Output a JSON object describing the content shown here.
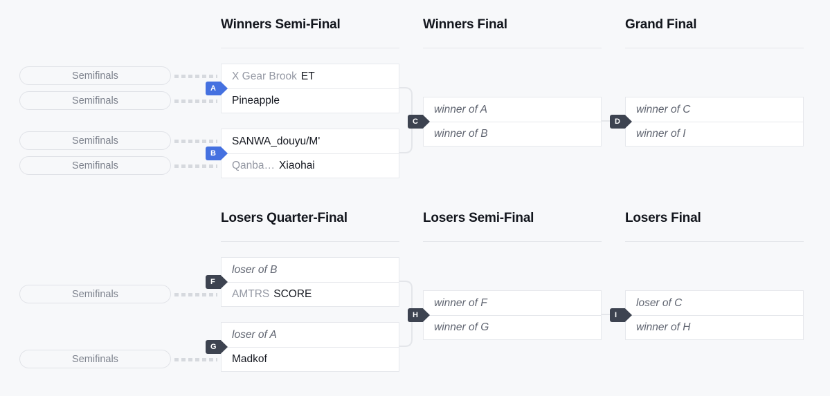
{
  "theme": {
    "background": "#f7f8fa",
    "card_background": "#ffffff",
    "border": "#e6e8ec",
    "heading_color": "#12151c",
    "badge_blue": "#4571e0",
    "badge_dark": "#3d4350",
    "placeholder_color": "#5f6470",
    "prefix_color": "#9498a3"
  },
  "rounds": [
    {
      "id": "winners-semi-final",
      "title": "Winners Semi-Final"
    },
    {
      "id": "winners-final",
      "title": "Winners Final"
    },
    {
      "id": "grand-final",
      "title": "Grand Final"
    },
    {
      "id": "losers-quarter-final",
      "title": "Losers Quarter-Final"
    },
    {
      "id": "losers-semi-final",
      "title": "Losers Semi-Final"
    },
    {
      "id": "losers-final",
      "title": "Losers Final"
    }
  ],
  "matches": [
    {
      "id": "match-a",
      "letter": "A",
      "badge_style": "blue",
      "round": "Winners Semi-Final",
      "slots": [
        {
          "prefix": "X Gear Brook",
          "name": "ET",
          "placeholder": false
        },
        {
          "prefix": "",
          "name": "Pineapple",
          "placeholder": false
        }
      ]
    },
    {
      "id": "match-b",
      "letter": "B",
      "badge_style": "blue",
      "round": "Winners Semi-Final",
      "slots": [
        {
          "prefix": "",
          "name": "SANWA_douyu/M'",
          "placeholder": false
        },
        {
          "prefix": "Qanba…",
          "name": "Xiaohai",
          "placeholder": false
        }
      ]
    },
    {
      "id": "match-c",
      "letter": "C",
      "badge_style": "dark",
      "round": "Winners Final",
      "slots": [
        {
          "prefix": "",
          "name": "winner of A",
          "placeholder": true
        },
        {
          "prefix": "",
          "name": "winner of B",
          "placeholder": true
        }
      ]
    },
    {
      "id": "match-d",
      "letter": "D",
      "badge_style": "dark",
      "round": "Grand Final",
      "slots": [
        {
          "prefix": "",
          "name": "winner of C",
          "placeholder": true
        },
        {
          "prefix": "",
          "name": "winner of I",
          "placeholder": true
        }
      ]
    },
    {
      "id": "match-f",
      "letter": "F",
      "badge_style": "dark",
      "round": "Losers Quarter-Final",
      "slots": [
        {
          "prefix": "",
          "name": "loser of B",
          "placeholder": true
        },
        {
          "prefix": "AMTRS",
          "name": "SCORE",
          "placeholder": false
        }
      ]
    },
    {
      "id": "match-g",
      "letter": "G",
      "badge_style": "dark",
      "round": "Losers Quarter-Final",
      "slots": [
        {
          "prefix": "",
          "name": "loser of A",
          "placeholder": true
        },
        {
          "prefix": "",
          "name": "Madkof",
          "placeholder": false
        }
      ]
    },
    {
      "id": "match-h",
      "letter": "H",
      "badge_style": "dark",
      "round": "Losers Semi-Final",
      "slots": [
        {
          "prefix": "",
          "name": "winner of F",
          "placeholder": true
        },
        {
          "prefix": "",
          "name": "winner of G",
          "placeholder": true
        }
      ]
    },
    {
      "id": "match-i",
      "letter": "I",
      "badge_style": "dark",
      "round": "Losers Final",
      "slots": [
        {
          "prefix": "",
          "name": "loser of C",
          "placeholder": true
        },
        {
          "prefix": "",
          "name": "winner of H",
          "placeholder": true
        }
      ]
    }
  ],
  "seed_pills": [
    {
      "id": "pill-a-top",
      "label": "Semifinals"
    },
    {
      "id": "pill-a-bottom",
      "label": "Semifinals"
    },
    {
      "id": "pill-b-top",
      "label": "Semifinals"
    },
    {
      "id": "pill-b-bottom",
      "label": "Semifinals"
    },
    {
      "id": "pill-f-bottom",
      "label": "Semifinals"
    },
    {
      "id": "pill-g-bottom",
      "label": "Semifinals"
    }
  ]
}
